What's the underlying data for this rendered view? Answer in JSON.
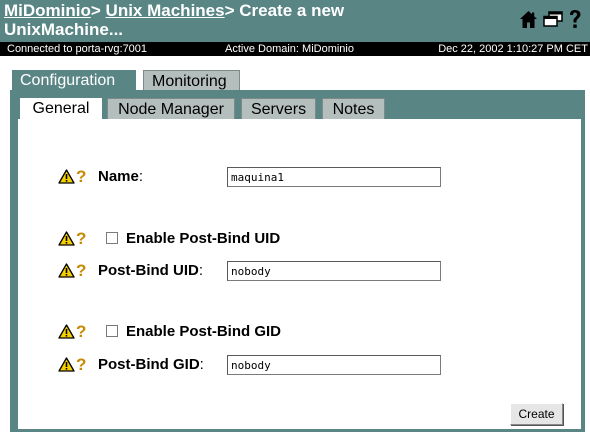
{
  "header": {
    "breadcrumbs": [
      {
        "label": "MiDominio",
        "link": true
      },
      {
        "label": "> ",
        "link": false
      },
      {
        "label": "Unix Machines",
        "link": true
      },
      {
        "label": "> Create a new UnixMachine...",
        "link": false
      }
    ],
    "icons": [
      "home-icon",
      "windows-icon",
      "help-icon"
    ]
  },
  "status": {
    "connection": "Connected to porta-rvg:7001",
    "domain": "Active Domain: MiDominio",
    "datetime": "Dec 22, 2002 1:10:27 PM CET"
  },
  "tabs": {
    "outer": [
      {
        "label": "Configuration",
        "active": true
      },
      {
        "label": "Monitoring",
        "active": false
      }
    ],
    "inner": [
      {
        "label": "General",
        "active": true
      },
      {
        "label": "Node Manager",
        "active": false
      },
      {
        "label": "Servers",
        "active": false
      },
      {
        "label": "Notes",
        "active": false
      }
    ]
  },
  "form": {
    "name_label": "Name",
    "name_value": "maquina1",
    "enable_uid_label": "Enable Post-Bind UID",
    "enable_uid_checked": false,
    "uid_label": "Post-Bind UID",
    "uid_value": "nobody",
    "enable_gid_label": "Enable Post-Bind GID",
    "enable_gid_checked": false,
    "gid_label": "Post-Bind GID",
    "gid_value": "nobody",
    "colon": ":",
    "help_glyph": "?",
    "create_label": "Create"
  },
  "colors": {
    "header_bg": "#5a8585",
    "status_bg": "#000000",
    "inactive_tab": "#b4bfbd",
    "warning_yellow": "#f5d000",
    "help_orange": "#c58a00"
  }
}
